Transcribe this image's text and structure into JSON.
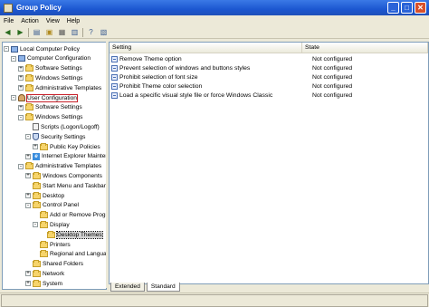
{
  "window": {
    "title": "Group Policy",
    "controls": [
      "minimize-icon",
      "maximize-icon",
      "close-icon"
    ]
  },
  "menu": [
    "File",
    "Action",
    "View",
    "Help"
  ],
  "toolbar": {
    "icons": [
      "back-arrow-icon",
      "forward-arrow-icon",
      "show-hide-tree-icon",
      "up-level-icon",
      "properties-icon",
      "export-list-icon",
      "help-icon",
      "help-topics-icon"
    ]
  },
  "tree": {
    "items": [
      {
        "label": "Local Computer Policy",
        "indent": 0,
        "expander": "-",
        "icon": "computer-policy-icon"
      },
      {
        "label": "Computer Configuration",
        "indent": 1,
        "expander": "-",
        "icon": "computer-icon"
      },
      {
        "label": "Software Settings",
        "indent": 2,
        "expander": "+",
        "icon": "folder-icon"
      },
      {
        "label": "Windows Settings",
        "indent": 2,
        "expander": "+",
        "icon": "folder-icon"
      },
      {
        "label": "Administrative Templates",
        "indent": 2,
        "expander": "+",
        "icon": "folder-icon"
      },
      {
        "label": "User Configuration",
        "indent": 1,
        "expander": "-",
        "icon": "user-icon",
        "highlighted": true
      },
      {
        "label": "Software Settings",
        "indent": 2,
        "expander": "+",
        "icon": "folder-icon"
      },
      {
        "label": "Windows Settings",
        "indent": 2,
        "expander": "-",
        "icon": "folder-icon"
      },
      {
        "label": "Scripts (Logon/Logoff)",
        "indent": 3,
        "expander": "",
        "icon": "script-icon"
      },
      {
        "label": "Security Settings",
        "indent": 3,
        "expander": "-",
        "icon": "security-icon"
      },
      {
        "label": "Public Key Policies",
        "indent": 4,
        "expander": "+",
        "icon": "folder-icon"
      },
      {
        "label": "Internet Explorer Mainter",
        "indent": 3,
        "expander": "+",
        "icon": "ie-icon"
      },
      {
        "label": "Administrative Templates",
        "indent": 2,
        "expander": "-",
        "icon": "folder-icon"
      },
      {
        "label": "Windows Components",
        "indent": 3,
        "expander": "+",
        "icon": "folder-icon"
      },
      {
        "label": "Start Menu and Taskbar",
        "indent": 3,
        "expander": "",
        "icon": "folder-icon"
      },
      {
        "label": "Desktop",
        "indent": 3,
        "expander": "+",
        "icon": "folder-icon"
      },
      {
        "label": "Control Panel",
        "indent": 3,
        "expander": "-",
        "icon": "folder-icon"
      },
      {
        "label": "Add or Remove Progr",
        "indent": 4,
        "expander": "",
        "icon": "folder-icon"
      },
      {
        "label": "Display",
        "indent": 4,
        "expander": "-",
        "icon": "folder-icon"
      },
      {
        "label": "Desktop Themes",
        "indent": 5,
        "expander": "",
        "icon": "folder-icon",
        "selected": true
      },
      {
        "label": "Printers",
        "indent": 4,
        "expander": "",
        "icon": "folder-icon"
      },
      {
        "label": "Regional and Languag",
        "indent": 4,
        "expander": "",
        "icon": "folder-icon"
      },
      {
        "label": "Shared Folders",
        "indent": 3,
        "expander": "",
        "icon": "folder-icon"
      },
      {
        "label": "Network",
        "indent": 3,
        "expander": "+",
        "icon": "folder-icon"
      },
      {
        "label": "System",
        "indent": 3,
        "expander": "+",
        "icon": "folder-icon"
      }
    ]
  },
  "list": {
    "columns": [
      "Setting",
      "State"
    ],
    "rows": [
      {
        "setting": "Remove Theme option",
        "state": "Not configured"
      },
      {
        "setting": "Prevent selection of windows and buttons styles",
        "state": "Not configured"
      },
      {
        "setting": "Prohibit selection of font size",
        "state": "Not configured"
      },
      {
        "setting": "Prohibit Theme color selection",
        "state": "Not configured"
      },
      {
        "setting": "Load a specific visual style file or force Windows Classic",
        "state": "Not configured"
      }
    ]
  },
  "tabs": [
    {
      "label": "Extended",
      "active": false
    },
    {
      "label": "Standard",
      "active": true
    }
  ]
}
